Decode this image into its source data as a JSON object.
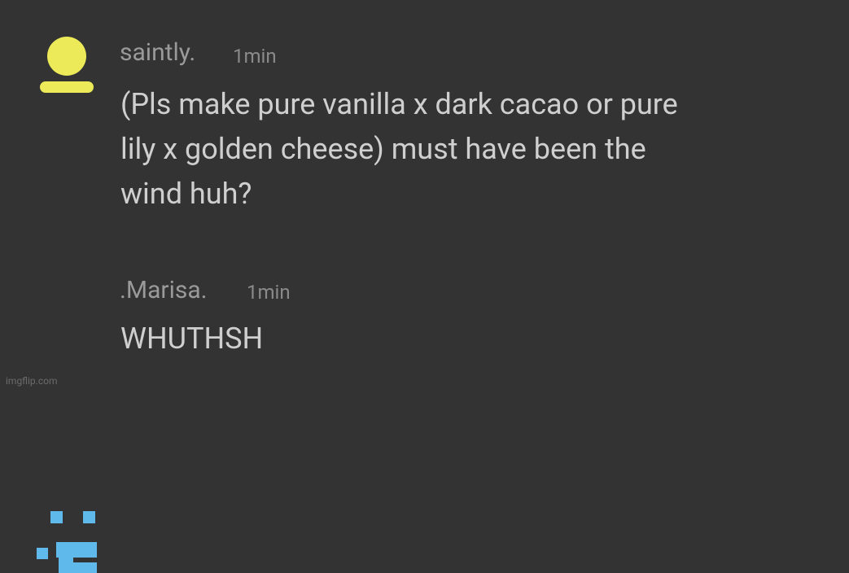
{
  "messages": [
    {
      "username": "saintly.",
      "timestamp": "1min",
      "text": "(Pls make pure vanilla x dark cacao or pure\nlily x golden cheese) must have been the\nwind huh?",
      "avatar_icon": "person-silhouette-icon",
      "avatar_color": "#ecea58"
    },
    {
      "username": ".Marisa.",
      "timestamp": "1min",
      "text": "WHUTHSH",
      "avatar_icon": "pixel-face-icon",
      "avatar_color": "#5fb9ea"
    }
  ],
  "watermark": "imgflip.com",
  "colors": {
    "background": "#333333",
    "username": "#9a9a9a",
    "timestamp": "#8a8a8a",
    "message_text": "#cfcfcf"
  }
}
